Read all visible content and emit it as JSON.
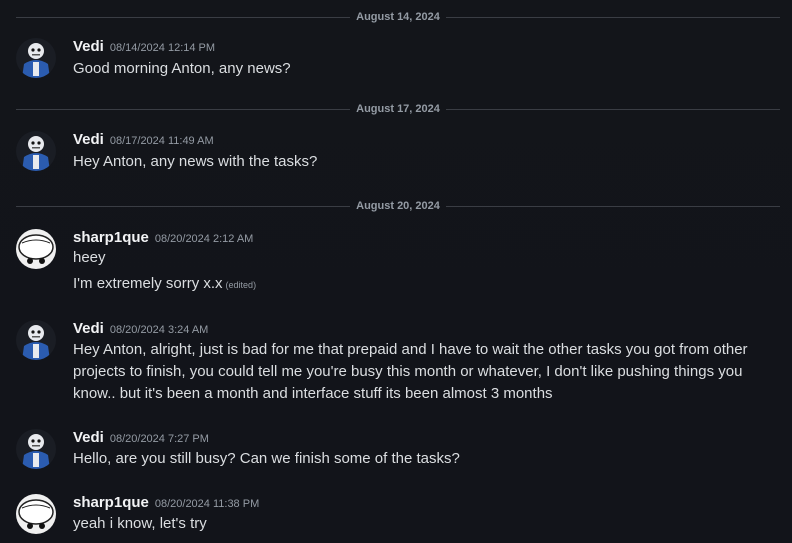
{
  "dividers": [
    {
      "label": "August 14, 2024"
    },
    {
      "label": "August 17, 2024"
    },
    {
      "label": "August 20, 2024"
    }
  ],
  "messages": [
    {
      "avatar": "skeleton-avatar-icon",
      "username": "Vedi",
      "timestamp": "08/14/2024 12:14 PM",
      "lines": [
        "Good morning Anton, any news?"
      ]
    },
    {
      "avatar": "skeleton-avatar-icon",
      "username": "Vedi",
      "timestamp": "08/17/2024 11:49 AM",
      "lines": [
        "Hey Anton, any news with the tasks?"
      ]
    },
    {
      "avatar": "ghost-avatar-icon",
      "username": "sharp1que",
      "timestamp": "08/20/2024 2:12 AM",
      "lines": [
        "heey",
        "I'm extremely sorry x.x"
      ],
      "edited": "(edited)"
    },
    {
      "avatar": "skeleton-avatar-icon",
      "username": "Vedi",
      "timestamp": "08/20/2024 3:24 AM",
      "lines": [
        "Hey Anton, alright, just is bad for me that prepaid and I have to wait the other tasks you got from other projects to finish, you could tell me you're busy this month or whatever, I don't like pushing things you know.. but it's been a month and interface stuff its been almost 3 months"
      ]
    },
    {
      "avatar": "skeleton-avatar-icon",
      "username": "Vedi",
      "timestamp": "08/20/2024 7:27 PM",
      "lines": [
        "Hello, are you still busy? Can we finish some of the tasks?"
      ]
    },
    {
      "avatar": "ghost-avatar-icon",
      "username": "sharp1que",
      "timestamp": "08/20/2024 11:38 PM",
      "lines": [
        "yeah i know, let's try"
      ]
    }
  ],
  "colors": {
    "background": "#12141a",
    "username": "#f2f3f5",
    "text": "#dbdee1",
    "muted": "#949ba4",
    "divider": "#3a3d44",
    "avatar_blue": "#2b5cb0"
  }
}
